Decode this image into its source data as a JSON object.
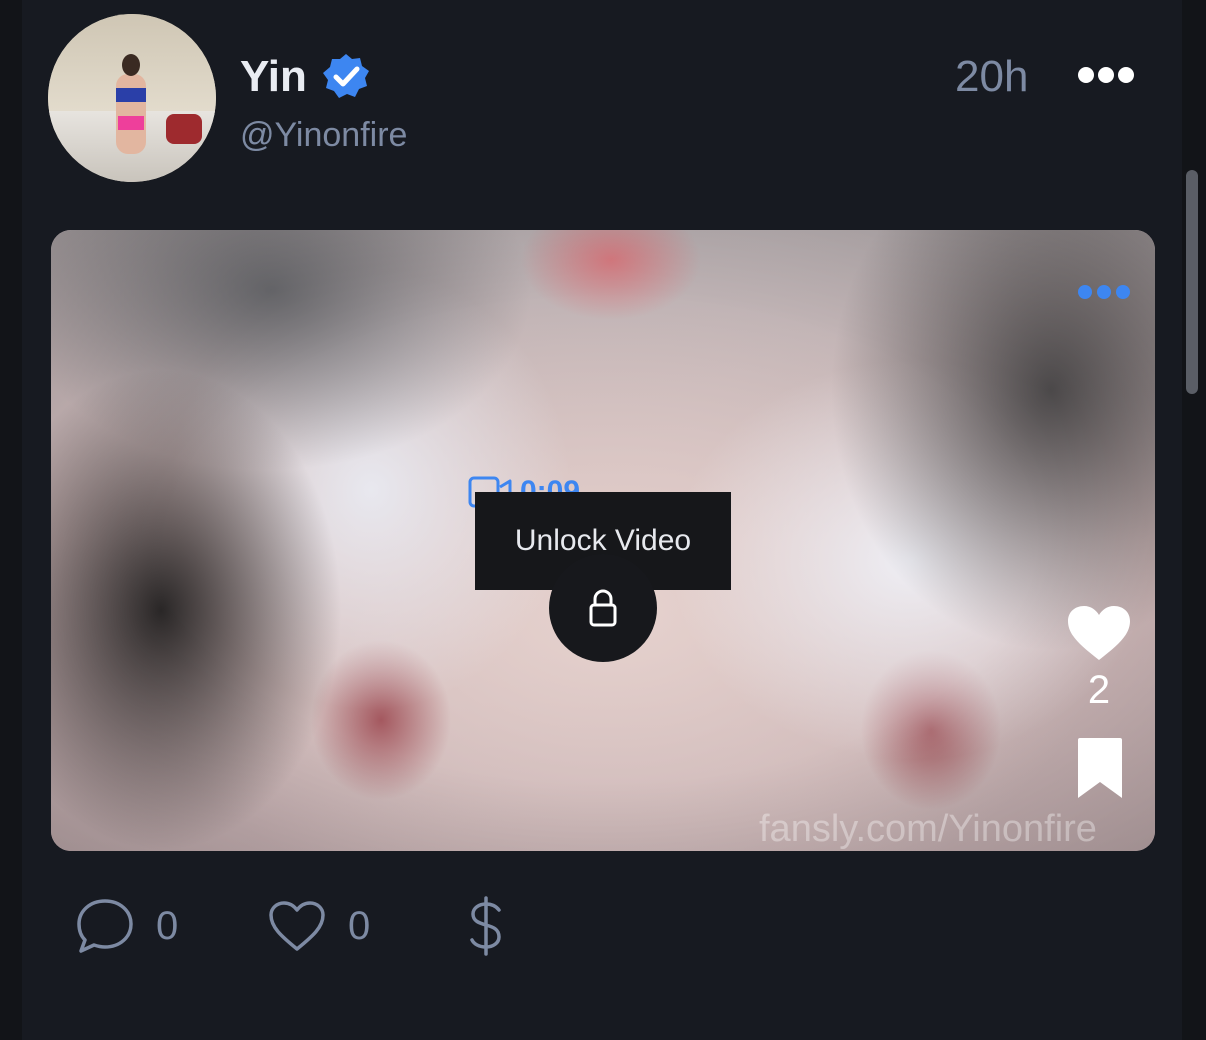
{
  "post": {
    "author": {
      "name": "Yin",
      "handle": "@Yinonfire",
      "verified": true
    },
    "timestamp": "20h"
  },
  "media": {
    "duration": "0:09",
    "unlock_label": "Unlock Video",
    "likes": "2",
    "watermark": "fansly.com/Yinonfire"
  },
  "actions": {
    "comments_count": "0",
    "likes_count": "0"
  },
  "colors": {
    "background": "#171a21",
    "accent": "#3d86f1",
    "muted_text": "#7d8aa3"
  }
}
